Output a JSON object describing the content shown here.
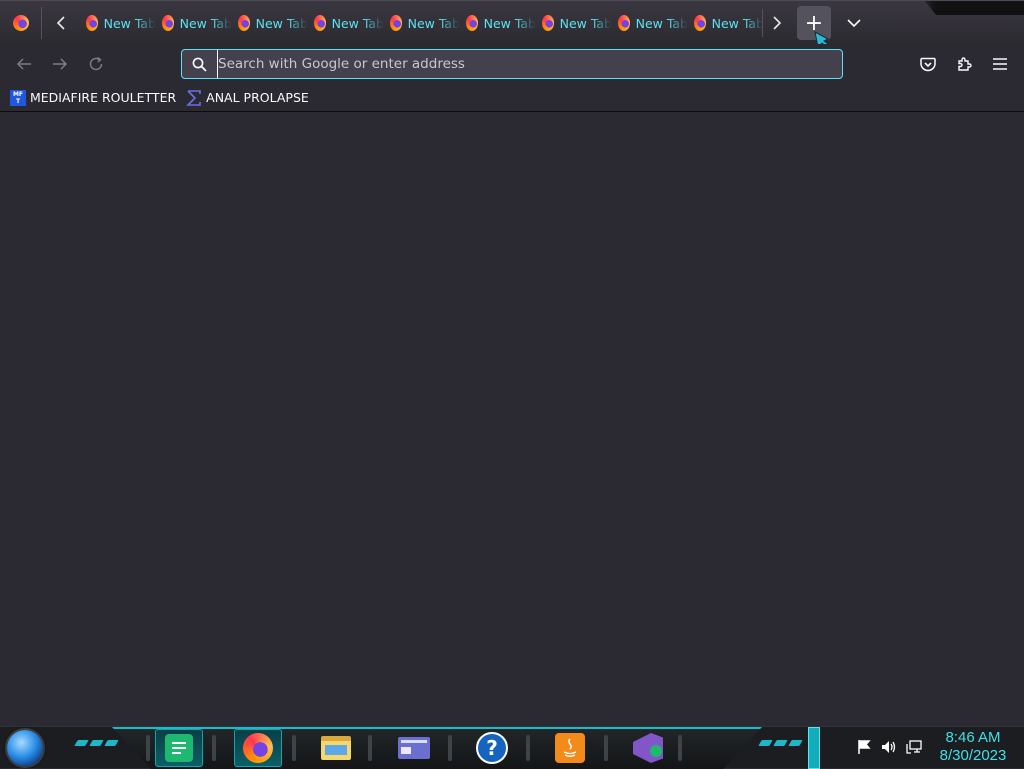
{
  "browser": {
    "tabs": [
      {
        "title": "New Tab"
      },
      {
        "title": "New Tab"
      },
      {
        "title": "New Tab"
      },
      {
        "title": "New Tab"
      },
      {
        "title": "New Tab"
      },
      {
        "title": "New Tab"
      },
      {
        "title": "New Tab"
      },
      {
        "title": "New Tab"
      },
      {
        "title": "New Tab"
      }
    ],
    "new_tab_label": "+",
    "urlbar": {
      "placeholder": "Search with Google or enter address",
      "value": ""
    },
    "bookmarks": [
      {
        "label": "MEDIAFIRE ROULETTER",
        "icon": "mediafire-icon",
        "icon_text": "MF T"
      },
      {
        "label": "ANAL PROLAPSE",
        "icon": "sigma-icon"
      }
    ]
  },
  "taskbar": {
    "apps": [
      {
        "name": "notes",
        "icon": "notes-icon"
      },
      {
        "name": "firefox",
        "icon": "firefox-icon"
      },
      {
        "name": "file-explorer",
        "icon": "folder-icon"
      },
      {
        "name": "card",
        "icon": "card-icon"
      },
      {
        "name": "help",
        "icon": "help-icon",
        "glyph": "?"
      },
      {
        "name": "java",
        "icon": "java-icon"
      },
      {
        "name": "visual-studio-installer",
        "icon": "visual-studio-icon"
      }
    ],
    "clock": {
      "time": "8:46 AM",
      "date": "8/30/2023"
    }
  },
  "colors": {
    "accent": "#5ee2f1",
    "background": "#2b2a33",
    "toolbar_field": "#42414d",
    "clock": "#3fe0e8"
  }
}
